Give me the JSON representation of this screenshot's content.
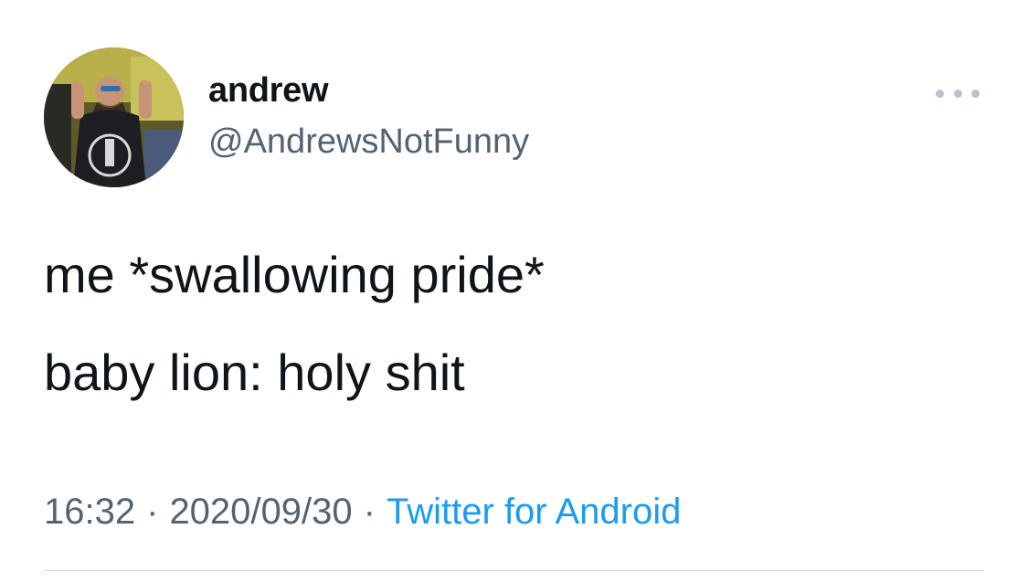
{
  "author": {
    "display_name": "andrew",
    "handle": "@AndrewsNotFunny",
    "avatar_description_icon": "profile-photo"
  },
  "tweet": {
    "lines": [
      "me *swallowing pride*",
      "baby lion: holy shit"
    ]
  },
  "meta": {
    "time": "16:32",
    "separator": "·",
    "date": "2020/09/30",
    "source": "Twitter for Android"
  },
  "colors": {
    "text": "#0f1419",
    "secondary": "#536471",
    "link": "#1d9bf0",
    "divider": "#cfd9de"
  },
  "icons": {
    "more": "more-horizontal-icon"
  }
}
